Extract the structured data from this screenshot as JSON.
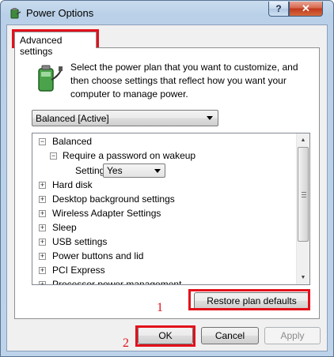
{
  "window": {
    "title": "Power Options",
    "help_glyph": "?",
    "close_glyph": "✕"
  },
  "tab": {
    "label": "Advanced settings"
  },
  "description": "Select the power plan that you want to customize, and then choose settings that reflect how you want your computer to manage power.",
  "plan_select": {
    "value": "Balanced [Active]"
  },
  "tree": {
    "root": {
      "label": "Balanced",
      "expander": "⊟"
    },
    "child": {
      "label": "Require a password on wakeup",
      "expander": "⊟"
    },
    "setting": {
      "label": "Setting:",
      "value": "Yes"
    },
    "items": [
      {
        "label": "Hard disk",
        "expander": "+"
      },
      {
        "label": "Desktop background settings",
        "expander": "+"
      },
      {
        "label": "Wireless Adapter Settings",
        "expander": "+"
      },
      {
        "label": "Sleep",
        "expander": "+"
      },
      {
        "label": "USB settings",
        "expander": "+"
      },
      {
        "label": "Power buttons and lid",
        "expander": "+"
      },
      {
        "label": "PCI Express",
        "expander": "+"
      },
      {
        "label": "Processor power management",
        "expander": "+"
      }
    ]
  },
  "buttons": {
    "restore": "Restore plan defaults",
    "ok": "OK",
    "cancel": "Cancel",
    "apply": "Apply"
  },
  "callouts": {
    "first": "1",
    "second": "2"
  },
  "colors": {
    "highlight": "#e3101b",
    "titlebar": "#bcd3ea",
    "close": "#c1381b"
  },
  "icons": {
    "title": "power-options-icon",
    "plan": "power-plug-battery-icon"
  }
}
